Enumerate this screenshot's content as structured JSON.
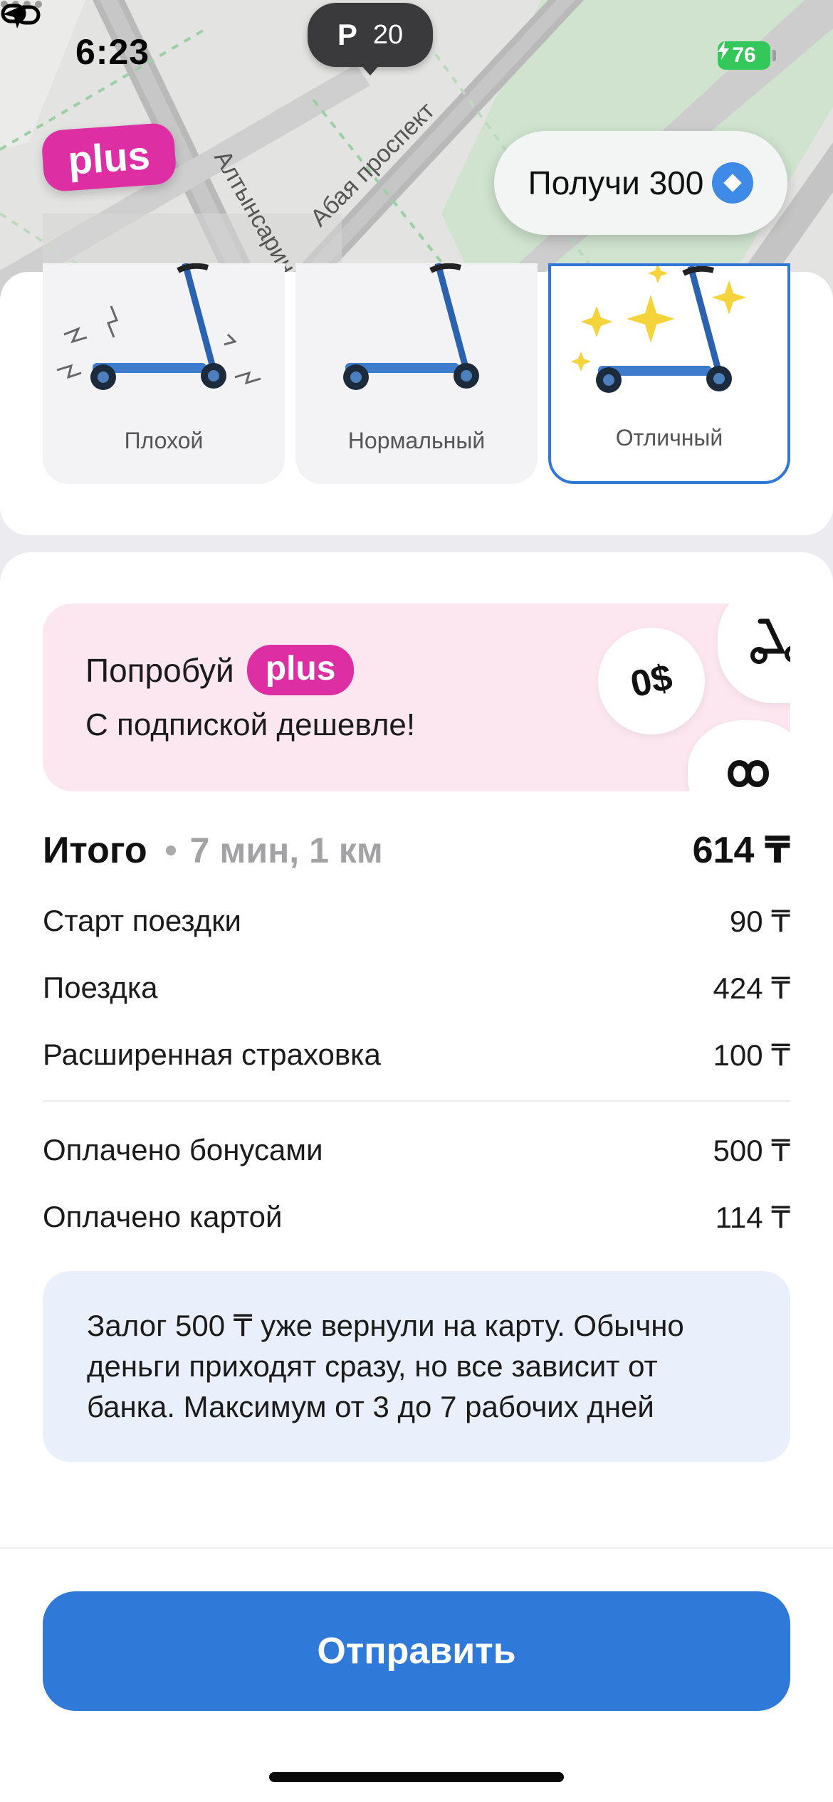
{
  "status_bar": {
    "time": "6:23",
    "battery": "76"
  },
  "map": {
    "parking": {
      "letter": "P",
      "count": "20"
    },
    "streets": [
      "Алтынсарина",
      "Абая проспект"
    ],
    "plus_badge": "plus",
    "get_bonus_label": "Получи 300"
  },
  "condition": {
    "options": [
      {
        "label": "Плохой",
        "selected": false
      },
      {
        "label": "Нормальный",
        "selected": false
      },
      {
        "label": "Отличный",
        "selected": true
      }
    ],
    "selected_color": "#3178d6"
  },
  "promo": {
    "try_label": "Попробуй",
    "plus_label": "plus",
    "subtitle": "С подпиской дешевле!",
    "zero_label": "0$"
  },
  "summary": {
    "total_label": "Итого",
    "total_meta": "7 мин, 1 км",
    "total_value": "614 ₸",
    "lines": [
      {
        "label": "Старт поездки",
        "value": "90 ₸"
      },
      {
        "label": "Поездка",
        "value": "424 ₸"
      },
      {
        "label": "Расширенная страховка",
        "value": "100 ₸"
      }
    ],
    "payments": [
      {
        "label": "Оплачено бонусами",
        "value": "500 ₸"
      },
      {
        "label": "Оплачено картой",
        "value": "114 ₸"
      }
    ]
  },
  "notice": "Залог 500 ₸ уже вернули на карту.  Обычно деньги приходят сразу, но все зависит от банка. Максимум от 3 до 7 рабочих дней",
  "send_button": "Отправить",
  "colors": {
    "accent_blue": "#2f7ad9",
    "plus_pink": "#de2ea3",
    "promo_bg": "#fce7f0",
    "notice_bg": "#e9f0fc"
  }
}
